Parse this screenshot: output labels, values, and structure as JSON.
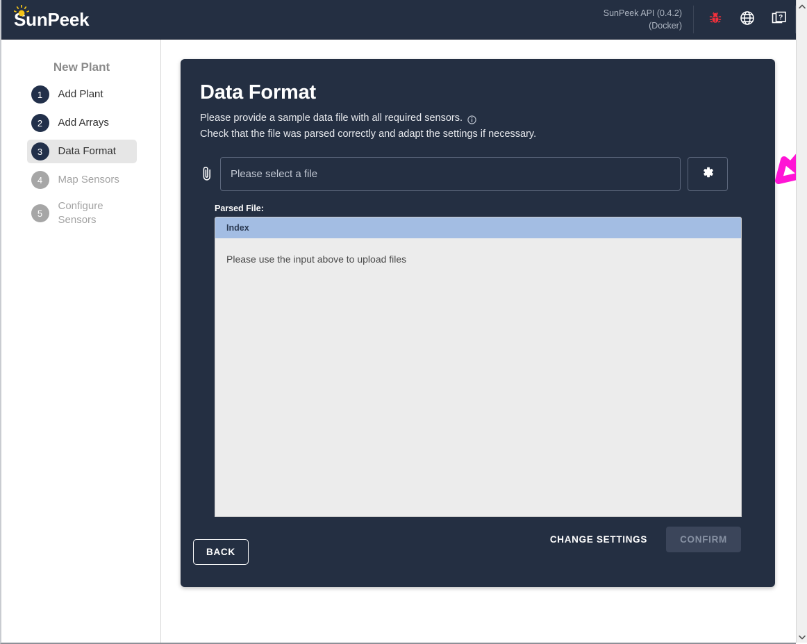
{
  "header": {
    "brand": "SunPeek",
    "brand_icon": "sun-icon",
    "api_version": "SunPeek API (0.4.2)\n(Docker)",
    "icons": [
      {
        "name": "bug-icon",
        "label": "Report a bug",
        "color": "#f5303b"
      },
      {
        "name": "globe-icon",
        "label": "Language",
        "color": "#ffffff"
      },
      {
        "name": "docs-icon",
        "label": "Documentation",
        "color": "#ffffff"
      }
    ],
    "background": "#242f42"
  },
  "sidebar": {
    "title": "New Plant",
    "items": [
      {
        "number": "1",
        "label": "Add Plant",
        "state": "done"
      },
      {
        "number": "2",
        "label": "Add Arrays",
        "state": "done"
      },
      {
        "number": "3",
        "label": "Data Format",
        "state": "active"
      },
      {
        "number": "4",
        "label": "Map Sensors",
        "state": "disabled"
      },
      {
        "number": "5",
        "label": "Configure Sensors",
        "state": "disabled"
      }
    ]
  },
  "card": {
    "title": "Data Format",
    "subtitle_line_1": "Please provide a sample data file with all required sensors.",
    "subtitle_line_2": "Check that the file was parsed correctly and adapt the settings if necessary.",
    "info_icon": "info-circle-icon",
    "file_input": {
      "icon": "paperclip-icon",
      "placeholder": "Please select a file",
      "value": ""
    },
    "settings_gear": {
      "icon": "gear-icon",
      "label": "Settings"
    },
    "parsed_file_label": "Parsed File:",
    "table": {
      "columns": [
        "Index"
      ],
      "empty_message": "Please use the input above to upload files",
      "header_color": "#a3bde3",
      "body_color": "#ececec"
    },
    "actions": {
      "change_settings": "CHANGE SETTINGS",
      "confirm": "CONFIRM",
      "confirm_disabled": true,
      "back": "BACK"
    },
    "background": "#242f42"
  },
  "annotation": {
    "type": "hand-drawn-arrow",
    "color": "#ff14d5",
    "points_to": "file-input-row"
  },
  "scrollbar": {
    "up_arrow": "chevron-up-icon",
    "down_arrow": "chevron-down-icon"
  }
}
